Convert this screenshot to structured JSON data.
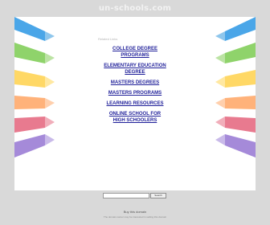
{
  "page": {
    "domain_title": "un-schools.com"
  },
  "main": {
    "related_label": "Related Links",
    "links": [
      {
        "line1": "COLLEGE DEGREE",
        "line2": "PROGRAMS"
      },
      {
        "line1": "ELEMENTARY EDUCATION",
        "line2": "DEGREE"
      },
      {
        "line1": "MASTERS DEGREES",
        "line2": ""
      },
      {
        "line1": "MASTERS PROGRAMS",
        "line2": ""
      },
      {
        "line1": "LEARNING RESOURCES",
        "line2": ""
      },
      {
        "line1": "ONLINE SCHOOL FOR",
        "line2": "HIGH SCHOOLERS"
      }
    ]
  },
  "search": {
    "button_label": "Search",
    "placeholder": ""
  },
  "footer": {
    "buy_domain": "Buy this domain",
    "note": "The domain owner may be interested in selling this domain"
  },
  "colors": {
    "band_colors": [
      "#4aa6e8",
      "#8fd36b",
      "#ffd866",
      "#ffb27a",
      "#e87a8f",
      "#a58ad9"
    ],
    "link_color": "#1f1f99",
    "background": "#d9d9d9"
  }
}
